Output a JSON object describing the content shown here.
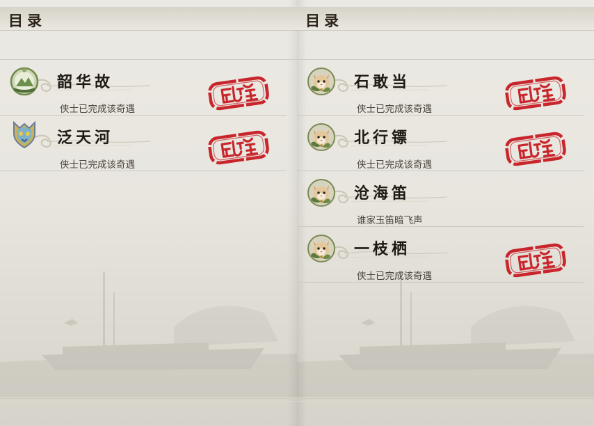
{
  "left_panel": {
    "header_title": "目录",
    "entries": [
      {
        "title": "韶华故",
        "subtitle": "侠士已完成该奇遇",
        "icon": "green-mountain-badge-icon",
        "completed": true
      },
      {
        "title": "泛天河",
        "subtitle": "侠士已完成该奇遇",
        "icon": "blue-crest-badge-icon",
        "completed": true
      }
    ]
  },
  "right_panel": {
    "header_title": "目录",
    "entries": [
      {
        "title": "石敢当",
        "subtitle": "侠士已完成该奇遇",
        "icon": "cat-pet-icon",
        "completed": true
      },
      {
        "title": "北行镖",
        "subtitle": "侠士已完成该奇遇",
        "icon": "cat-pet-icon",
        "completed": true
      },
      {
        "title": "沧海笛",
        "subtitle": "谁家玉笛暗飞声",
        "icon": "cat-pet-icon",
        "completed": false
      },
      {
        "title": "一枝栖",
        "subtitle": "侠士已完成该奇遇",
        "icon": "cat-pet-icon",
        "completed": true
      }
    ]
  },
  "colors": {
    "stamp_red": "#c8262c",
    "title_ink": "#1f1913",
    "paper": "#e8e6df"
  }
}
